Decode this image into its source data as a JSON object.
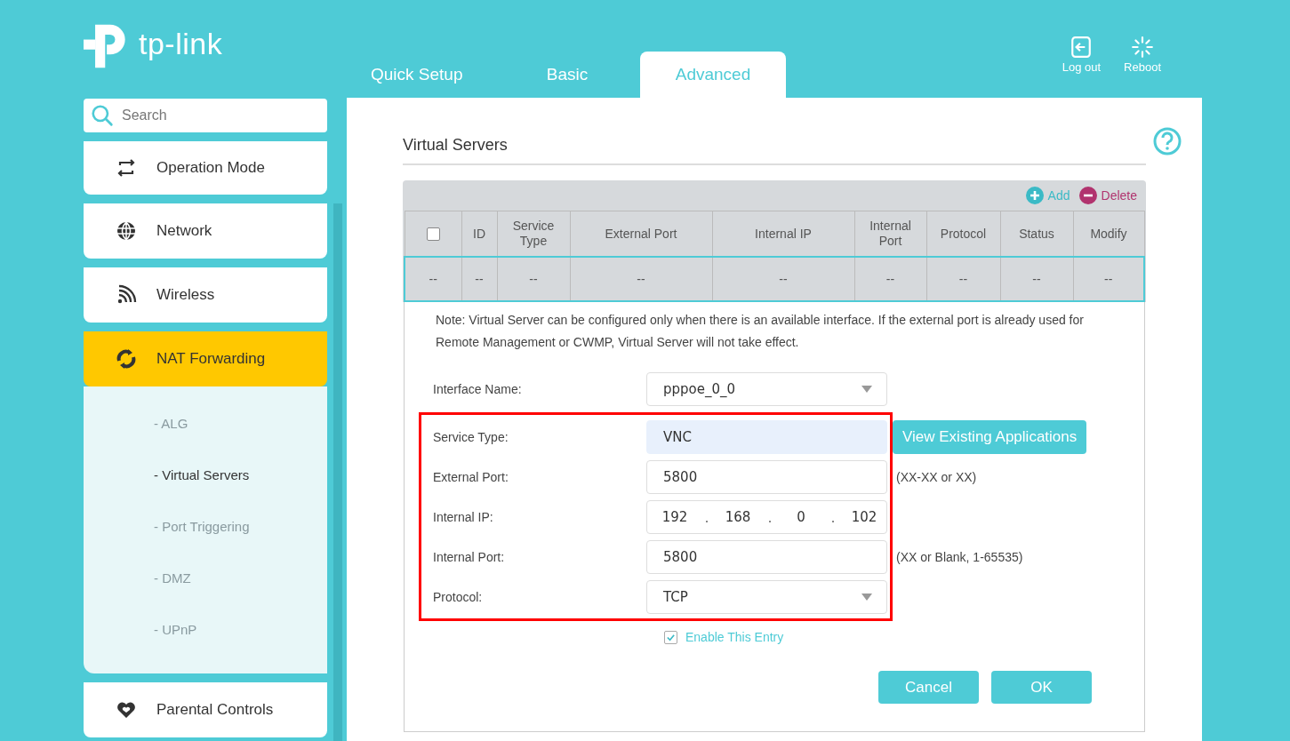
{
  "logo": "tp-link",
  "tabs": [
    {
      "label": "Quick Setup",
      "selected": false
    },
    {
      "label": "Basic",
      "selected": false
    },
    {
      "label": "Advanced",
      "selected": true
    }
  ],
  "header_actions": [
    {
      "kind": "logout",
      "label": "Log out"
    },
    {
      "kind": "reboot",
      "label": "Reboot"
    }
  ],
  "search": {
    "placeholder": "Search"
  },
  "sidebar": {
    "items": [
      {
        "kind": "operation",
        "label": "Operation Mode",
        "selected": false,
        "expanded": false
      },
      {
        "kind": "network",
        "label": "Network",
        "selected": false,
        "expanded": false
      },
      {
        "kind": "wireless",
        "label": "Wireless",
        "selected": false,
        "expanded": false
      },
      {
        "kind": "nat",
        "label": "NAT Forwarding",
        "selected": true,
        "expanded": true,
        "children": [
          {
            "label": "- ALG",
            "selected": false
          },
          {
            "label": "- Virtual Servers",
            "selected": true
          },
          {
            "label": "- Port Triggering",
            "selected": false
          },
          {
            "label": "- DMZ",
            "selected": false
          },
          {
            "label": "- UPnP",
            "selected": false
          }
        ]
      },
      {
        "kind": "parental",
        "label": "Parental Controls",
        "selected": false,
        "expanded": false
      }
    ]
  },
  "page_title": "Virtual Servers",
  "table": {
    "actions": [
      {
        "kind": "add",
        "label": "Add"
      },
      {
        "kind": "delete",
        "label": "Delete"
      }
    ],
    "select_all": {
      "checked": false
    },
    "columns": [
      "",
      "ID",
      "Service Type",
      "External Port",
      "Internal IP",
      "Internal Port",
      "Protocol",
      "Status",
      "Modify"
    ],
    "rows": [
      [
        "--",
        "--",
        "--",
        "--",
        "--",
        "--",
        "--",
        "--",
        "--"
      ]
    ]
  },
  "note": "Note: Virtual Server can be configured only when there is an available interface. If the external port is already used for Remote Management or CWMP, Virtual Server will not take effect.",
  "form": {
    "fields": [
      {
        "kind": "select",
        "label": "Interface Name:",
        "value": "pppoe_0_0",
        "highlighted": false
      },
      {
        "kind": "input",
        "label": "Service Type:",
        "value": "VNC",
        "focused": true,
        "button": "View Existing Applications",
        "highlighted": true
      },
      {
        "kind": "input",
        "label": "External Port:",
        "value": "5800",
        "focused": false,
        "hint": "(XX-XX or XX)",
        "highlighted": true
      },
      {
        "kind": "ip",
        "label": "Internal IP:",
        "parts": [
          "192",
          "168",
          "0",
          "102"
        ],
        "highlighted": true
      },
      {
        "kind": "input",
        "label": "Internal Port:",
        "value": "5800",
        "focused": false,
        "hint": "(XX or Blank, 1-65535)",
        "highlighted": true
      },
      {
        "kind": "select",
        "label": "Protocol:",
        "value": "TCP",
        "highlighted": true
      }
    ],
    "enable": {
      "label": "Enable This Entry",
      "checked": true
    },
    "buttons": [
      "Cancel",
      "OK"
    ]
  }
}
